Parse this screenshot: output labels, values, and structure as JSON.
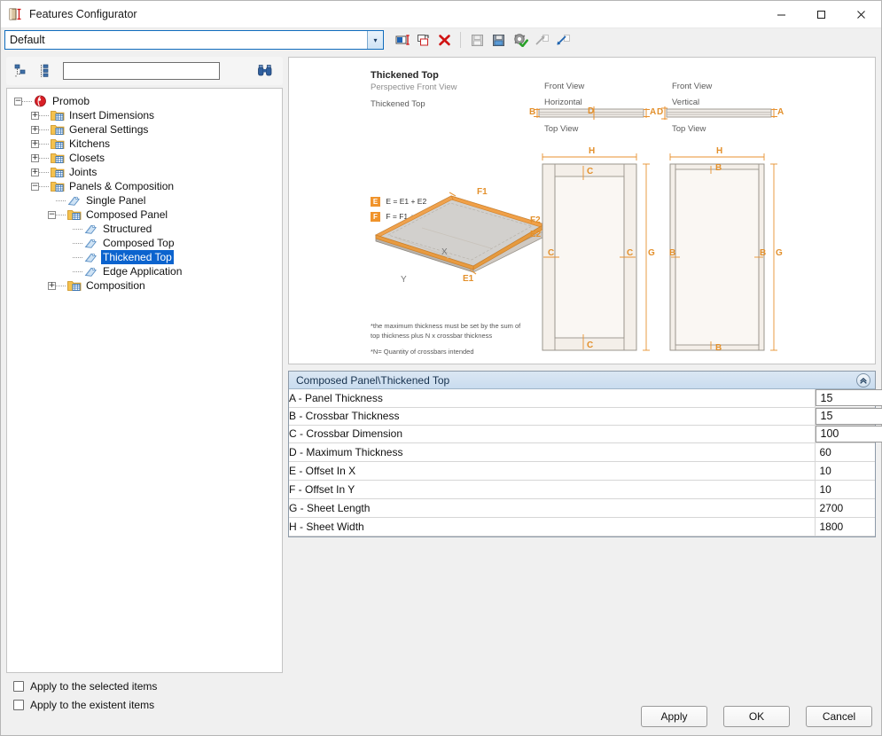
{
  "window": {
    "title": "Features Configurator",
    "icon": "panel-icon",
    "minimize": "–",
    "maximize": "☐",
    "close": "✕"
  },
  "profile_combo": {
    "value": "Default",
    "arrow": "▾"
  },
  "toolbar": {
    "buttons": [
      {
        "name": "rename-feature-button",
        "icon": "rename-icon"
      },
      {
        "name": "duplicate-feature-button",
        "icon": "copy-icon"
      },
      {
        "name": "delete-feature-button",
        "icon": "delete-x-icon"
      },
      {
        "name": "save-button",
        "icon": "save-disk-icon"
      },
      {
        "name": "save-as-button",
        "icon": "save-as-icon"
      },
      {
        "name": "settings-button",
        "icon": "gear-check-icon"
      },
      {
        "name": "import-button",
        "icon": "import-arrow-icon"
      },
      {
        "name": "export-button",
        "icon": "export-arrow-icon"
      }
    ]
  },
  "search": {
    "placeholder": "",
    "value": "",
    "collapse_all_icon": "collapse-tree-icon",
    "expand_all_icon": "expand-tree-icon",
    "find_icon": "binoculars-icon"
  },
  "tree": [
    {
      "label": "Promob",
      "depth": 0,
      "expander": "−",
      "icon": "promob-logo-icon",
      "selected": false
    },
    {
      "label": "Insert Dimensions",
      "depth": 1,
      "expander": "+",
      "icon": "folder-icon",
      "selected": false
    },
    {
      "label": "General Settings",
      "depth": 1,
      "expander": "+",
      "icon": "folder-icon",
      "selected": false
    },
    {
      "label": "Kitchens",
      "depth": 1,
      "expander": "+",
      "icon": "folder-icon",
      "selected": false
    },
    {
      "label": "Closets",
      "depth": 1,
      "expander": "+",
      "icon": "folder-icon",
      "selected": false
    },
    {
      "label": "Joints",
      "depth": 1,
      "expander": "+",
      "icon": "folder-icon",
      "selected": false
    },
    {
      "label": "Panels & Composition",
      "depth": 1,
      "expander": "−",
      "icon": "folder-icon",
      "selected": false
    },
    {
      "label": "Single Panel",
      "depth": 2,
      "expander": "",
      "icon": "tag-icon",
      "selected": false
    },
    {
      "label": "Composed Panel",
      "depth": 2,
      "expander": "−",
      "icon": "folder-icon",
      "selected": false
    },
    {
      "label": "Structured",
      "depth": 3,
      "expander": "",
      "icon": "tag-icon",
      "selected": false
    },
    {
      "label": "Composed Top",
      "depth": 3,
      "expander": "",
      "icon": "tag-icon",
      "selected": false
    },
    {
      "label": "Thickened Top",
      "depth": 3,
      "expander": "",
      "icon": "tag-icon",
      "selected": true
    },
    {
      "label": "Edge Application",
      "depth": 3,
      "expander": "",
      "icon": "tag-icon",
      "selected": false
    },
    {
      "label": "Composition",
      "depth": 2,
      "expander": "+",
      "icon": "folder-icon",
      "selected": false
    }
  ],
  "diagram": {
    "title": "Thickened Top",
    "subtitle": "Perspective Front View",
    "caption": "Thickened Top",
    "view_mid": {
      "title": "Front View",
      "sub": "Horizontal",
      "topview": "Top View"
    },
    "view_right": {
      "title": "Front View",
      "sub": "Vertical",
      "topview": "Top View"
    },
    "equations": {
      "e": "E = E1 + E2",
      "f": "F = F1 + F2",
      "e_badge": "E",
      "f_badge": "F"
    },
    "perspective_labels": {
      "x": "X",
      "y": "Y",
      "f1": "F1",
      "f2": "F2",
      "e1": "E1",
      "e2": "E2"
    },
    "mid_dims": {
      "b": "B",
      "d": "D",
      "a": "A",
      "h": "H",
      "g": "G",
      "c_top": "C",
      "c_left": "C",
      "c_right": "C",
      "c_bottom": "C"
    },
    "right_dims": {
      "d": "D",
      "a": "A",
      "h": "H",
      "g": "G",
      "b_top": "B",
      "b_left": "B",
      "b_right": "B",
      "b_bottom": "B"
    },
    "notes": [
      "*the maximum thickness must be set by the sum of top thickness plus N x crossbar thickness",
      "*N= Quantity of crossbars intended"
    ]
  },
  "properties": {
    "group_title": "Composed Panel\\Thickened Top",
    "collapse_icon": "«",
    "rows": [
      {
        "label": "A -  Panel Thickness",
        "value": "15",
        "type": "dropdown"
      },
      {
        "label": "B -  Crossbar Thickness",
        "value": "15",
        "type": "dropdown"
      },
      {
        "label": "C -  Crossbar Dimension",
        "value": "100",
        "type": "dropdown"
      },
      {
        "label": "D -  Maximum Thickness",
        "value": "60",
        "type": "text"
      },
      {
        "label": "E -  Offset In X",
        "value": "10",
        "type": "text"
      },
      {
        "label": "F -  Offset In Y",
        "value": "10",
        "type": "text"
      },
      {
        "label": "G -  Sheet Length",
        "value": "2700",
        "type": "text"
      },
      {
        "label": "H -  Sheet Width",
        "value": "1800",
        "type": "text"
      }
    ]
  },
  "footer": {
    "checkboxes": [
      {
        "label": "Apply to the selected items",
        "checked": false
      },
      {
        "label": "Apply to the existent items",
        "checked": false
      }
    ],
    "buttons": [
      {
        "label": "Apply",
        "name": "apply-button"
      },
      {
        "label": "OK",
        "name": "ok-button"
      },
      {
        "label": "Cancel",
        "name": "cancel-button"
      }
    ]
  },
  "colors": {
    "accent_orange": "#f0932b",
    "selection_blue": "#0b63ce",
    "panel_fill": "#f5eee8"
  }
}
